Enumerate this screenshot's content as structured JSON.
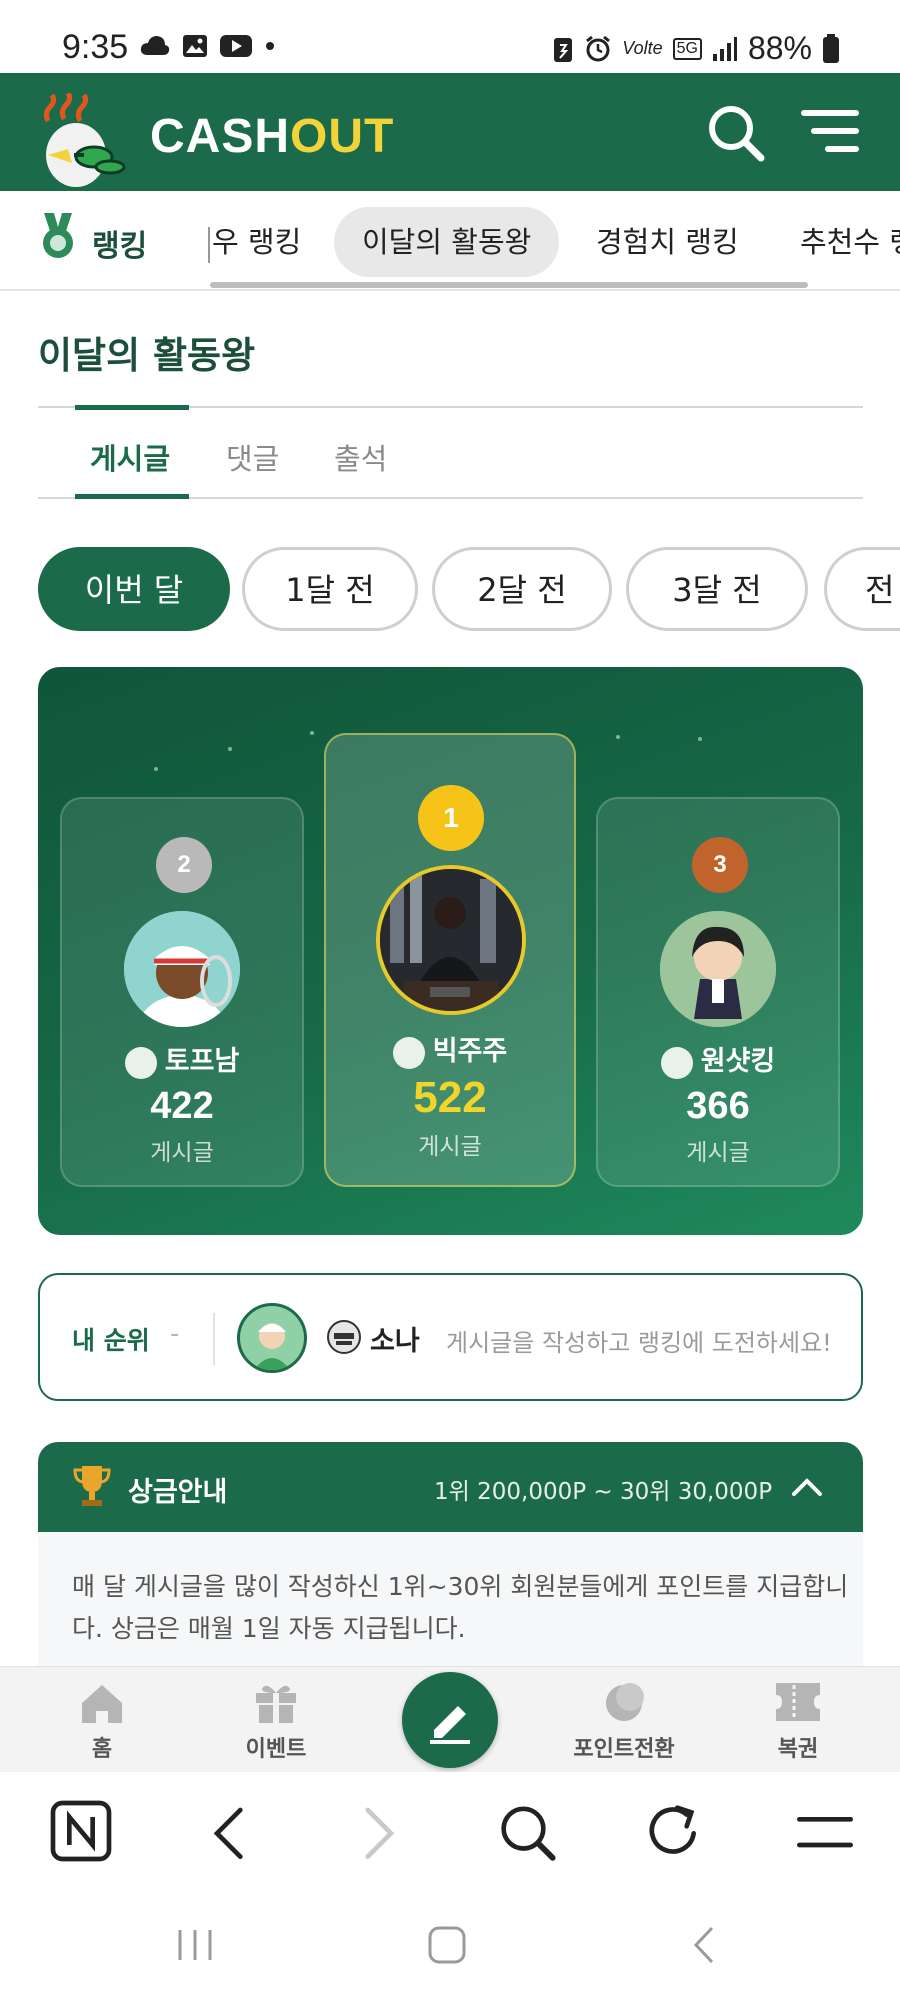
{
  "status_bar": {
    "time": "9:35",
    "battery": "88%",
    "network": "5G",
    "volte": "Volte"
  },
  "header": {
    "logo_cash": "CASH",
    "logo_out": "OUT",
    "search_icon": "search-icon",
    "menu_icon": "menu-icon"
  },
  "ranking_nav": {
    "title": "랭킹",
    "tabs": [
      {
        "label": "우 랭킹"
      },
      {
        "label": "이달의 활동왕",
        "active": true
      },
      {
        "label": "경험치 랭킹"
      },
      {
        "label": "추천수 랭"
      }
    ]
  },
  "page": {
    "title": "이달의 활동왕",
    "subtabs": [
      {
        "label": "게시글",
        "active": true
      },
      {
        "label": "댓글"
      },
      {
        "label": "출석"
      }
    ],
    "months": [
      {
        "label": "이번 달",
        "active": true
      },
      {
        "label": "1달 전"
      },
      {
        "label": "2달 전"
      },
      {
        "label": "3달 전"
      },
      {
        "label": "전"
      }
    ]
  },
  "podium": {
    "first": {
      "rank": "1",
      "name": "빅주주",
      "score": "522",
      "unit": "게시글"
    },
    "second": {
      "rank": "2",
      "name": "토프남",
      "score": "422",
      "unit": "게시글"
    },
    "third": {
      "rank": "3",
      "name": "원샷킹",
      "score": "366",
      "unit": "게시글"
    },
    "colors": {
      "gold": "#f1d52a",
      "silver": "#b9b9b9",
      "bronze": "#c0642b"
    }
  },
  "my_rank": {
    "label": "내 순위",
    "rank": "-",
    "name": "소나",
    "hint": "게시글을 작성하고 랭킹에 도전하세요!"
  },
  "prize": {
    "title": "상금안내",
    "range": "1위 200,000P ~ 30위 30,000P",
    "description": "매 달 게시글을 많이 작성하신 1위~30위 회원분들에게 포인트를 지급합니다. 상금은 매월 1일 자동 지급됩니다."
  },
  "tab_bar": {
    "items": [
      {
        "label": "홈",
        "icon": "home-icon"
      },
      {
        "label": "이벤트",
        "icon": "gift-icon"
      },
      {
        "label": "",
        "icon": "write-icon"
      },
      {
        "label": "포인트전환",
        "icon": "coin-icon"
      },
      {
        "label": "복권",
        "icon": "ticket-icon"
      }
    ]
  },
  "browser_bar": {
    "icons": [
      "naver-icon",
      "back-icon",
      "forward-icon",
      "search-icon",
      "refresh-icon",
      "menu-icon"
    ]
  },
  "accent_color": "#1b6b4a"
}
